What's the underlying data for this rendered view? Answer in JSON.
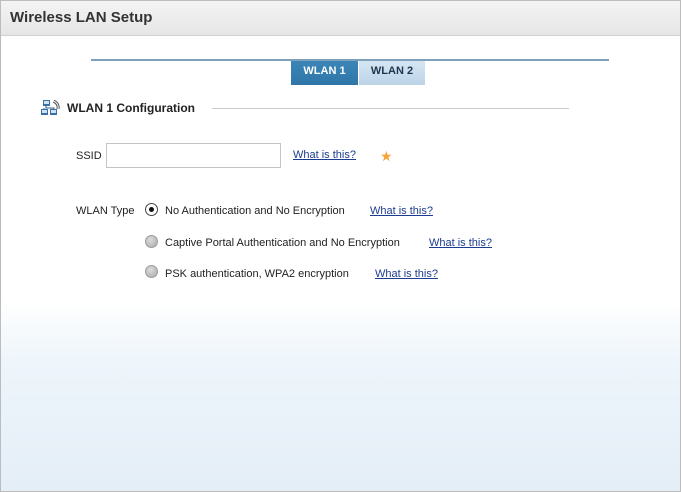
{
  "window": {
    "title": "Wireless LAN Setup"
  },
  "tabs": [
    {
      "label": "WLAN 1",
      "active": true
    },
    {
      "label": "WLAN 2",
      "active": false
    }
  ],
  "section": {
    "title": "WLAN 1 Configuration",
    "icon": "network-icon"
  },
  "ssid": {
    "label": "SSID",
    "value": "",
    "placeholder": "",
    "help_link": "What is this?",
    "required_marker": "★"
  },
  "wlan_type": {
    "label": "WLAN Type",
    "options": [
      {
        "label": "No Authentication and No Encryption",
        "selected": true,
        "help_link": "What is this?"
      },
      {
        "label": "Captive Portal Authentication and No Encryption",
        "selected": false,
        "help_link": "What is this?"
      },
      {
        "label": "PSK authentication, WPA2 encryption",
        "selected": false,
        "help_link": "What is this?"
      }
    ]
  },
  "colors": {
    "active_tab": "#3b86b7",
    "inactive_tab": "#c8dced",
    "link": "#1c3c8f",
    "required": "#f5a33a"
  }
}
